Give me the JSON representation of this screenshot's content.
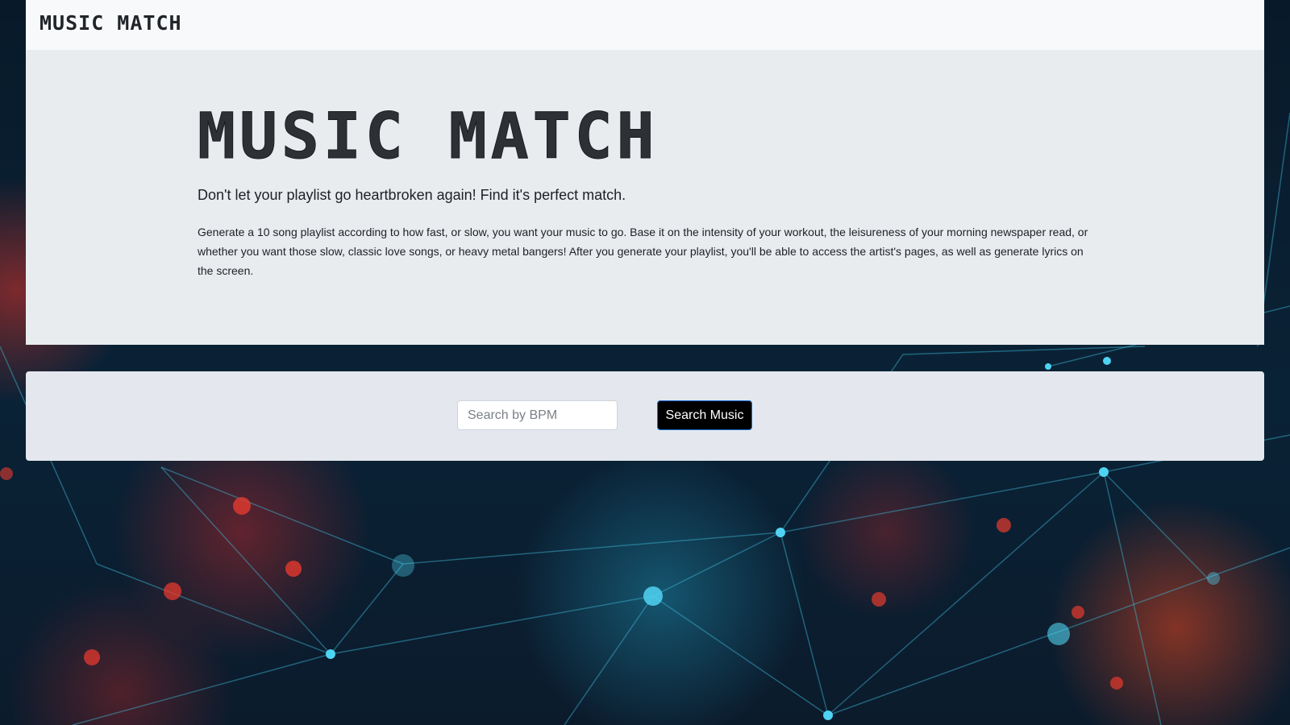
{
  "navbar": {
    "brand": "MUSIC MATCH"
  },
  "hero": {
    "title": "MUSIC MATCH",
    "tagline": "Don't let your playlist go heartbroken again! Find it's perfect match.",
    "description": "Generate a 10 song playlist according to how fast, or slow, you want your music to go. Base it on the intensity of your workout, the leisureness of your morning newspaper read, or whether you want those slow, classic love songs, or heavy metal bangers! After you generate your playlist, you'll be able to access the artist's pages, as well as generate lyrics on the screen."
  },
  "search": {
    "input_value": "",
    "input_placeholder": "Search by BPM",
    "button_label": "Search Music"
  },
  "colors": {
    "navbar_bg": "#f8f9fa",
    "hero_bg": "#e9ecef",
    "search_panel_bg": "#e4e8ee",
    "button_bg": "#000000",
    "button_border": "#1f6fd6",
    "page_bg": "#071826"
  }
}
